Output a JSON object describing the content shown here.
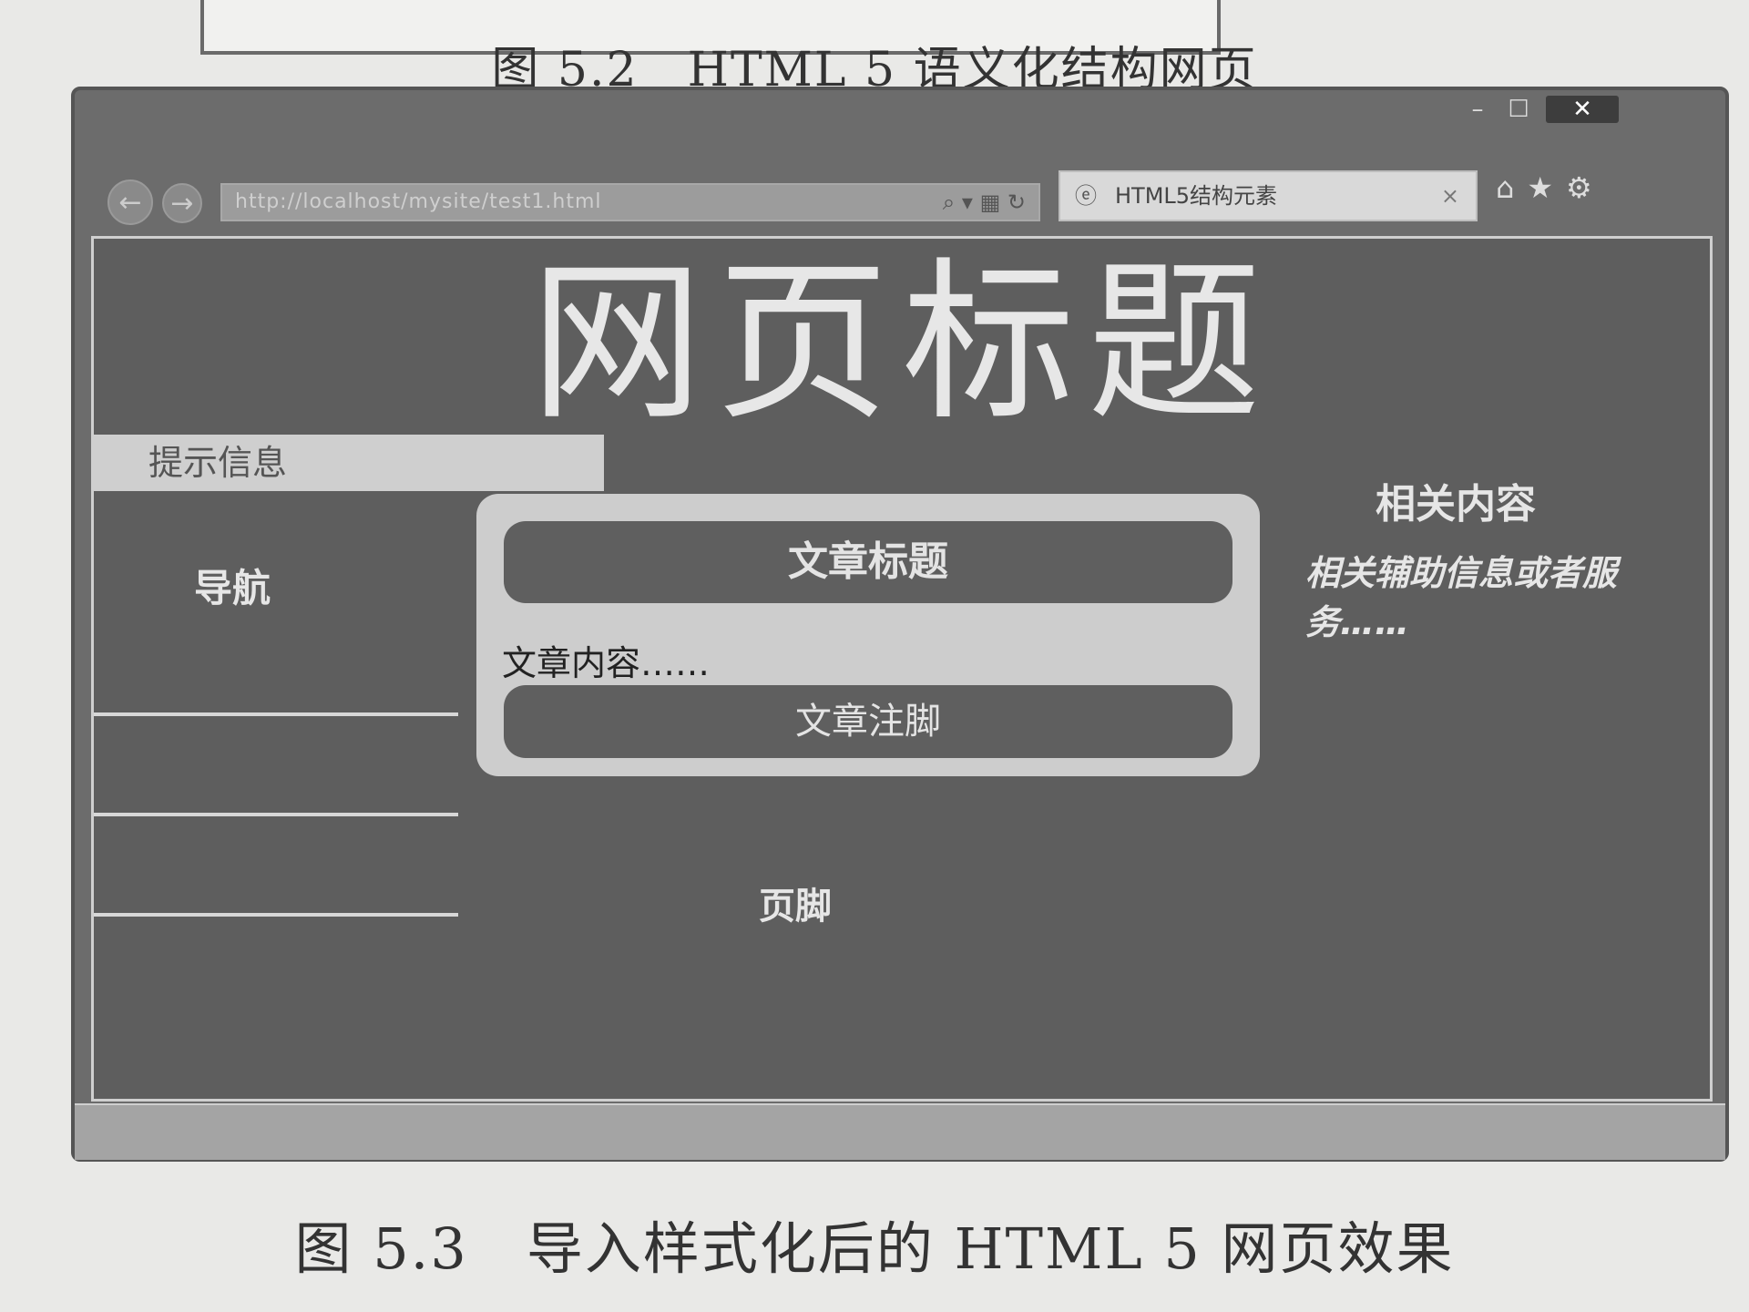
{
  "book": {
    "caption_top": "图 5.2　HTML 5 语义化结构网页",
    "caption_bottom": "图 5.3　导入样式化后的 HTML 5 网页效果"
  },
  "browser": {
    "address_url": "http://localhost/mysite/test1.html",
    "tab_title": "HTML5结构元素",
    "close_symbol": "✕",
    "tab_close_symbol": "×"
  },
  "page": {
    "title": "网页标题",
    "hint": "提示信息",
    "nav_heading": "导航",
    "article": {
      "header": "文章标题",
      "body": "文章内容……",
      "footer": "文章注脚"
    },
    "aside": {
      "heading": "相关内容",
      "text": "相关辅助信息或者服务……"
    },
    "footer": "页脚"
  },
  "colors": {
    "page_bg": "#5e5e5e",
    "article_bg": "#cdcdcd",
    "text_light": "#e6e6e6"
  }
}
